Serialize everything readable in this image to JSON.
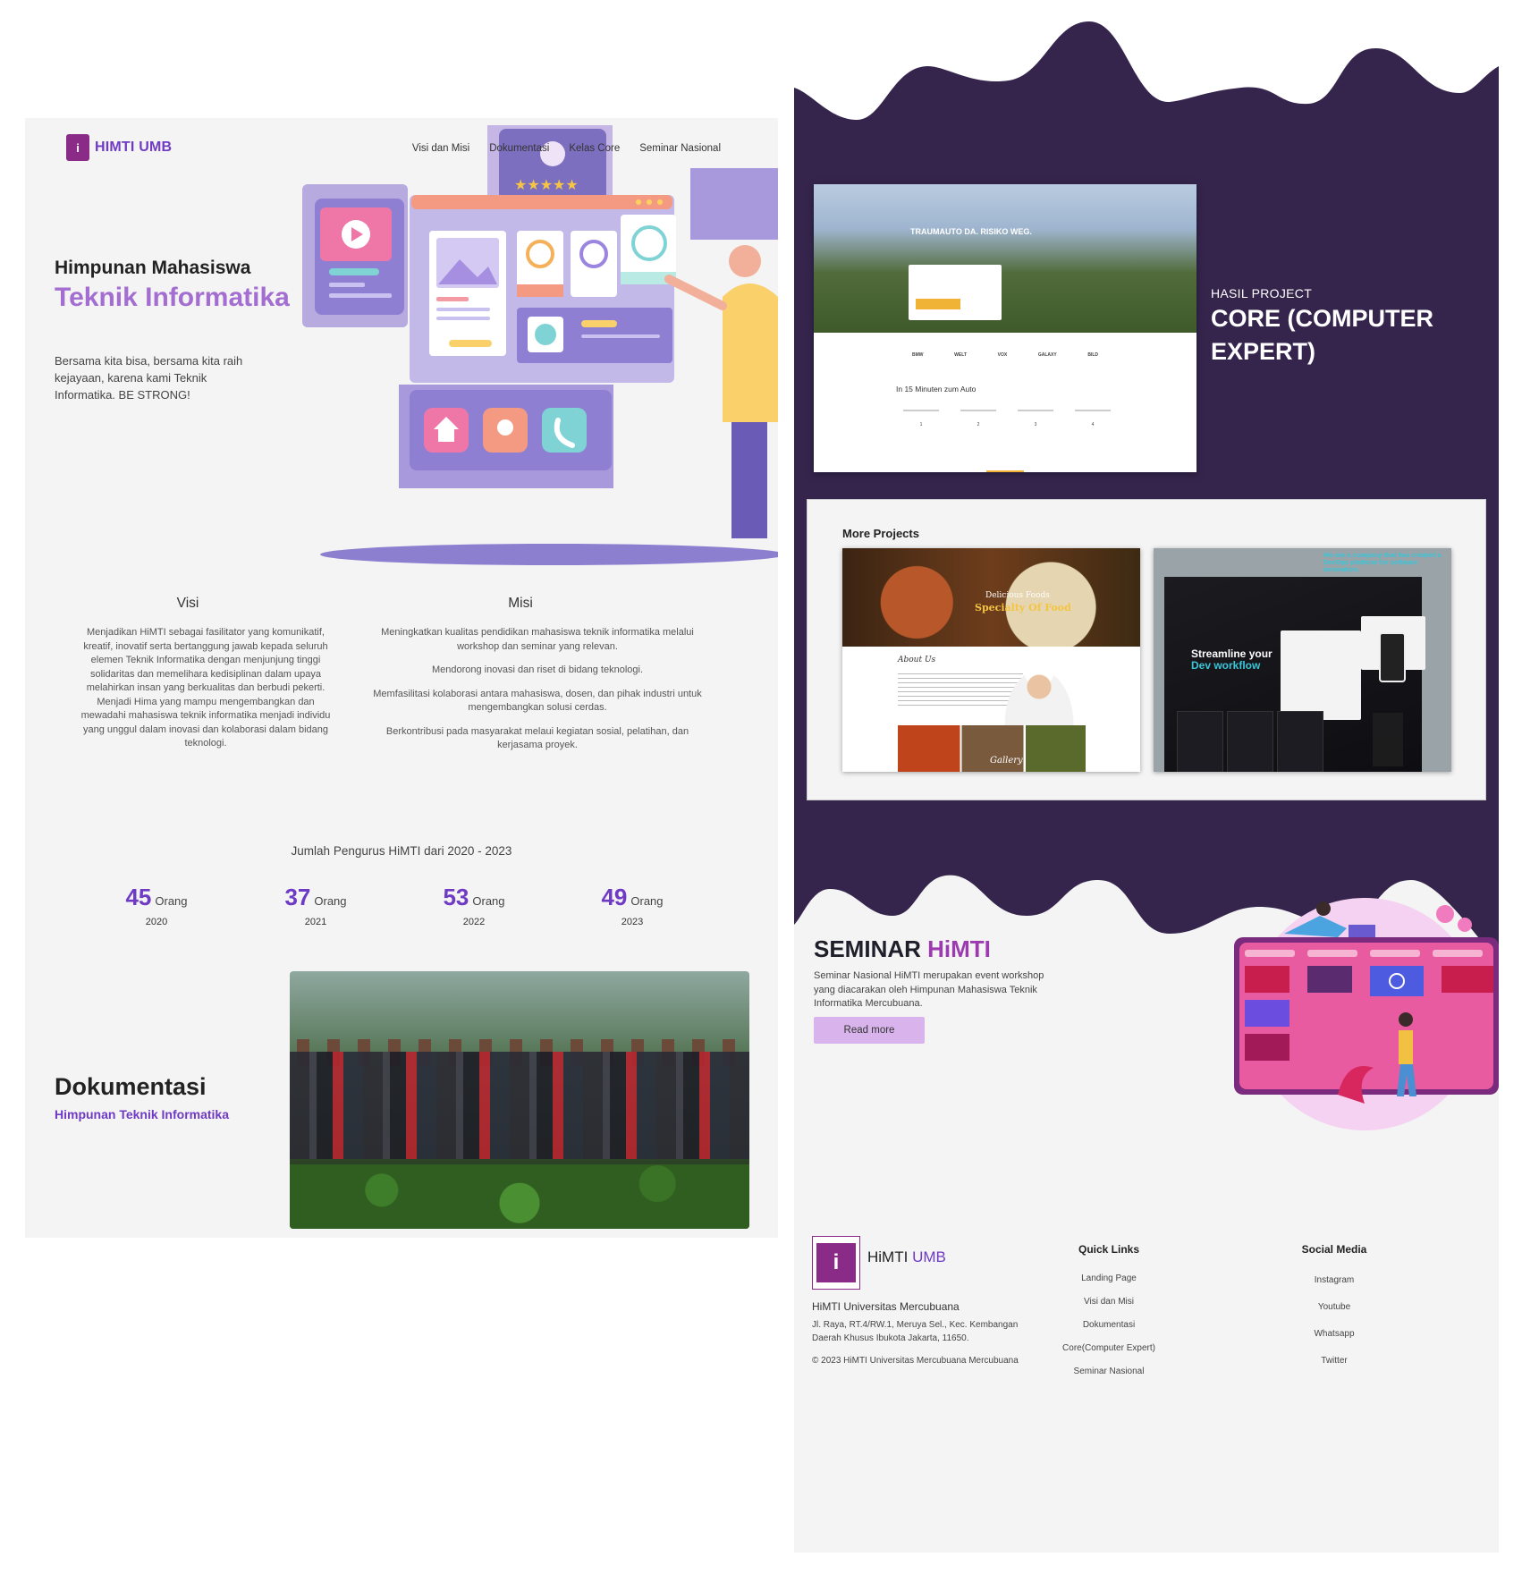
{
  "header": {
    "brand": "HIMTI UMB",
    "nav": [
      "Visi dan Misi",
      "Dokumentasi",
      "Kelas Core",
      "Seminar Nasional"
    ]
  },
  "hero": {
    "subtitle": "Himpunan Mahasiswa",
    "title": "Teknik Informatika",
    "description": "Bersama kita bisa, bersama kita raih kejayaan, karena kami Teknik Informatika. BE STRONG!"
  },
  "visi": {
    "title": "Visi",
    "text": "Menjadikan HiMTI sebagai fasilitator yang komunikatif, kreatif, inovatif serta bertanggung jawab kepada seluruh elemen Teknik Informatika dengan menjunjung tinggi solidaritas dan memelihara kedisiplinan dalam upaya melahirkan insan yang berkualitas dan berbudi pekerti. Menjadi Hima yang mampu mengembangkan dan mewadahi mahasiswa teknik informatika menjadi individu yang unggul dalam inovasi dan kolaborasi dalam bidang teknologi."
  },
  "misi": {
    "title": "Misi",
    "items": [
      "Meningkatkan kualitas pendidikan mahasiswa teknik informatika melalui workshop dan seminar yang relevan.",
      "Mendorong inovasi dan riset di bidang teknologi.",
      "Memfasilitasi kolaborasi antara mahasiswa, dosen, dan pihak industri untuk mengembangkan solusi cerdas.",
      "Berkontribusi pada masyarakat melaui kegiatan sosial, pelatihan, dan kerjasama proyek."
    ]
  },
  "stats": {
    "title": "Jumlah Pengurus HiMTI dari 2020 - 2023",
    "unit": "Orang",
    "items": [
      {
        "value": "45",
        "year": "2020"
      },
      {
        "value": "37",
        "year": "2021"
      },
      {
        "value": "53",
        "year": "2022"
      },
      {
        "value": "49",
        "year": "2023"
      }
    ]
  },
  "dokumentasi": {
    "title": "Dokumentasi",
    "subtitle": "Himpunan Teknik Informatika"
  },
  "core": {
    "label": "HASIL PROJECT",
    "title": "CORE (COMPUTER EXPERT)",
    "shot": {
      "headline": "TRAUMAUTO DA. RISIKO WEG.",
      "section": "In 15 Minuten zum Auto",
      "logos": [
        "BMW",
        "WELT",
        "VOX",
        "GALAXY",
        "BILD"
      ]
    },
    "more_title": "More Projects",
    "p1": {
      "line1": "Delicious Foods",
      "line2": "Specialty Of Food",
      "about": "About Us",
      "gallery": "Gallery"
    },
    "p2": {
      "headline1": "Streamline your",
      "headline2": "Dev workflow",
      "tagline": "We are a company that has created a DevOps platform for software innovation."
    }
  },
  "seminar": {
    "title_a": "SEMINAR",
    "title_b": "HiMTI",
    "description": "Seminar Nasional HiMTI merupakan event workshop yang diacarakan oleh Himpunan Mahasiswa Teknik Informatika Mercubuana.",
    "button": "Read more"
  },
  "footer": {
    "brand_a": "HiMTI",
    "brand_b": "UMB",
    "org": "HiMTI Universitas Mercubuana",
    "address": "Jl. Raya, RT.4/RW.1, Meruya Sel., Kec. Kembangan Daerah Khusus Ibukota Jakarta, 11650.",
    "copyright": "© 2023 HiMTI Universitas Mercubuana Mercubuana",
    "quick_title": "Quick Links",
    "quick_links": [
      "Landing Page",
      "Visi dan Misi",
      "Dokumentasi",
      "Core(Computer Expert)",
      "Seminar Nasional"
    ],
    "social_title": "Social Media",
    "social_links": [
      "Instagram",
      "Youtube",
      "Whatsapp",
      "Twitter"
    ]
  },
  "colors": {
    "primary": "#6f3ac4",
    "band": "#35254d",
    "accent": "#a36dd1"
  }
}
